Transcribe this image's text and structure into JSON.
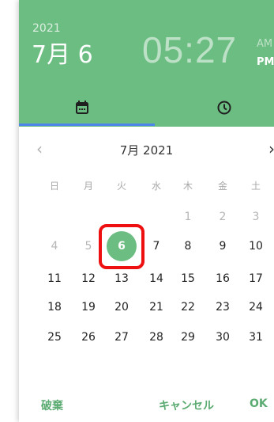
{
  "header": {
    "year": "2021",
    "date": "7月 6",
    "time": "05:27",
    "am_label": "AM",
    "pm_label": "PM",
    "accent_color": "#6cbd82",
    "tab_indicator_color": "#4f84ea",
    "tabs": [
      {
        "name": "date",
        "icon": "calendar-icon",
        "active": true
      },
      {
        "name": "time",
        "icon": "clock-icon",
        "active": false
      }
    ]
  },
  "calendar": {
    "month_label": "7月 2021",
    "prev_icon": "chevron-left-icon",
    "next_icon": "chevron-right-icon",
    "weekdays": [
      "日",
      "月",
      "火",
      "水",
      "木",
      "金",
      "土"
    ],
    "weeks": [
      [
        "",
        "",
        "",
        "",
        "1",
        "2",
        "3"
      ],
      [
        "4",
        "5",
        "6",
        "7",
        "8",
        "9",
        "10"
      ],
      [
        "11",
        "12",
        "13",
        "14",
        "15",
        "16",
        "17"
      ],
      [
        "18",
        "19",
        "20",
        "21",
        "22",
        "23",
        "24"
      ],
      [
        "25",
        "26",
        "27",
        "28",
        "29",
        "30",
        "31"
      ]
    ],
    "selected_day": "6"
  },
  "footer": {
    "discard_label": "破棄",
    "cancel_label": "キャンセル",
    "ok_label": "OK"
  }
}
